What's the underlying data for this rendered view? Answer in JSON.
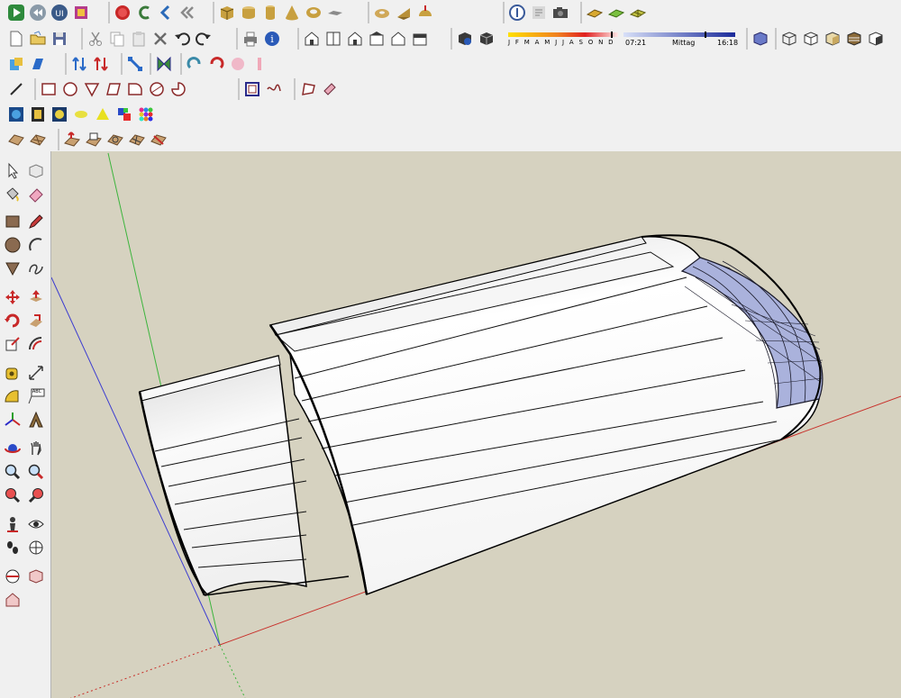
{
  "colors": {
    "background": "#d6d2c0",
    "axis_red": "#c8302a",
    "axis_green": "#3cb43c",
    "axis_blue": "#3c3cd0",
    "cap_face": "#aab2dc"
  },
  "shadow_settings": {
    "months": "J F M A M J J A S O N D",
    "sunrise_time": "07:21",
    "midday_label": "Mittag",
    "sunset_time": "16:18"
  },
  "toolbar_rows": [
    {
      "name": "standard-row-1",
      "icons": [
        "play-icon",
        "rewind-icon",
        "ui-icon",
        "component-icon",
        "record-icon",
        "follow-me-icon",
        "first-frame-icon",
        "back-icon",
        "box-icon",
        "cylinder-icon",
        "cylinder-tall-icon",
        "cone-icon",
        "tube-icon",
        "slab-icon",
        "torus-icon",
        "wedge-icon",
        "dome-icon",
        "xray-icon",
        "info-icon",
        "camera-icon",
        "terrain-icon",
        "terrain-green-icon",
        "grid-icon"
      ]
    },
    {
      "name": "standard-row-2",
      "icons": [
        "new-icon",
        "open-icon",
        "save-icon",
        "cut-icon",
        "copy-icon",
        "paste-icon",
        "erase-icon",
        "undo-icon",
        "redo-icon",
        "print-icon",
        "model-info-icon",
        "iso-view-icon",
        "top-view-icon",
        "front-view-icon",
        "right-view-icon",
        "back-view-icon",
        "left-view-icon",
        "shadow-info-icon",
        "display-shadow-icon",
        "xray-style-icon",
        "wireframe-icon",
        "hidden-line-icon",
        "shaded-icon",
        "shaded-texture-icon",
        "monochrome-icon"
      ]
    },
    {
      "name": "tools-row-3",
      "icons": [
        "section-icon",
        "push-icon",
        "flip-icon",
        "swap-icon",
        "scale-icon",
        "fold-icon",
        "rotate-icon",
        "rotate-back-icon",
        "mirror-icon",
        "bend-icon"
      ]
    },
    {
      "name": "drawing-row-4",
      "icons": [
        "line-icon",
        "rectangle-icon",
        "circle-icon",
        "triangle-icon",
        "parallelogram-icon",
        "arc-rect-icon",
        "circle-section-icon",
        "pie-icon",
        "offset-icon",
        "freehand-icon",
        "polygon-icon",
        "eraser-icon"
      ]
    },
    {
      "name": "plugins-row-5",
      "icons": [
        "film-icon",
        "filmstrip-icon",
        "sphere-icon",
        "sun-icon",
        "cone-yellow-icon",
        "color-swatch-icon",
        "dots-icon"
      ]
    },
    {
      "name": "sandbox-row-6",
      "icons": [
        "sandbox-contours-icon",
        "sandbox-scratch-icon",
        "smoove-icon",
        "stamp-icon",
        "drape-icon",
        "add-detail-icon",
        "flip-edge-icon"
      ]
    }
  ],
  "left_tools": [
    [
      "select-icon",
      "make-component-icon"
    ],
    [
      "paint-bucket-icon",
      "eraser-icon"
    ],
    [
      "rectangle-icon",
      "pencil-icon"
    ],
    [
      "circle-icon",
      "arc-icon"
    ],
    [
      "polygon-icon",
      "freehand-icon"
    ],
    [
      "move-icon",
      "push-pull-icon"
    ],
    [
      "rotate-icon",
      "follow-me-icon"
    ],
    [
      "scale-icon",
      "offset-icon"
    ],
    [
      "tape-measure-icon",
      "dimension-icon"
    ],
    [
      "protractor-icon",
      "text-icon"
    ],
    [
      "axes-icon",
      "3d-text-icon"
    ],
    [
      "orbit-icon",
      "pan-icon"
    ],
    [
      "zoom-icon",
      "zoom-window-icon"
    ],
    [
      "previous-view-icon",
      "next-view-icon"
    ],
    [
      "position-camera-icon",
      "look-around-icon"
    ],
    [
      "walk-icon",
      "section-plane-icon"
    ],
    [
      "section-fill-icon",
      "display-section-icon"
    ],
    [
      "display-section-cut-icon"
    ]
  ],
  "left_labels": {
    "text_tool": "ABC"
  }
}
